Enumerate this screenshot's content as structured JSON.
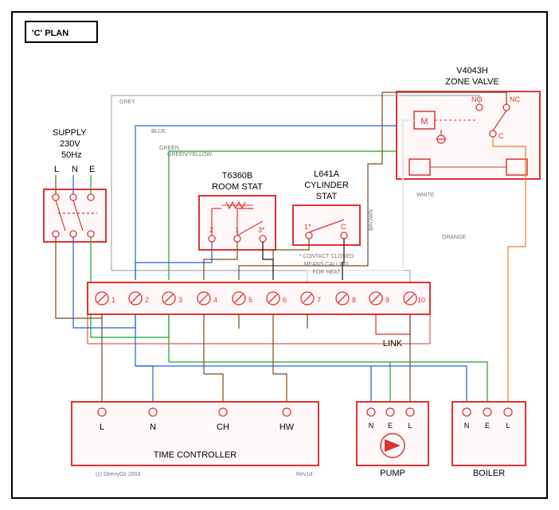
{
  "title": "'C' PLAN",
  "supply": {
    "label1": "SUPPLY",
    "label2": "230V",
    "label3": "50Hz",
    "L": "L",
    "N": "N",
    "E": "E"
  },
  "zone_valve": {
    "model": "V4043H",
    "name": "ZONE VALVE",
    "M": "M",
    "NO": "NO",
    "NC": "NC",
    "C": "C"
  },
  "room_stat": {
    "model": "T6360B",
    "name": "ROOM STAT",
    "t1": "1",
    "t2": "2",
    "t3": "3*"
  },
  "cylinder_stat": {
    "model": "L641A",
    "name1": "CYLINDER",
    "name2": "STAT",
    "t1": "1*",
    "tC": "C",
    "note1": "* CONTACT CLOSED",
    "note2": "MEANS CALLING",
    "note3": "FOR HEAT"
  },
  "junction": {
    "t1": "1",
    "t2": "2",
    "t3": "3",
    "t4": "4",
    "t5": "5",
    "t6": "6",
    "t7": "7",
    "t8": "8",
    "t9": "9",
    "t10": "10",
    "link": "LINK"
  },
  "controller": {
    "name": "TIME CONTROLLER",
    "L": "L",
    "N": "N",
    "CH": "CH",
    "HW": "HW"
  },
  "pump": {
    "name": "PUMP",
    "N": "N",
    "E": "E",
    "L": "L"
  },
  "boiler": {
    "name": "BOILER",
    "N": "N",
    "E": "E",
    "L": "L"
  },
  "wires": {
    "grey": "GREY",
    "blue": "BLUE",
    "green": "GREEN",
    "greenyellow": "GREEN/YELLOW",
    "brown": "BROWN",
    "white": "WHITE",
    "orange": "ORANGE"
  },
  "footer": {
    "rev": "Rev1d",
    "copy": "(c) DeevyOz 2003"
  }
}
